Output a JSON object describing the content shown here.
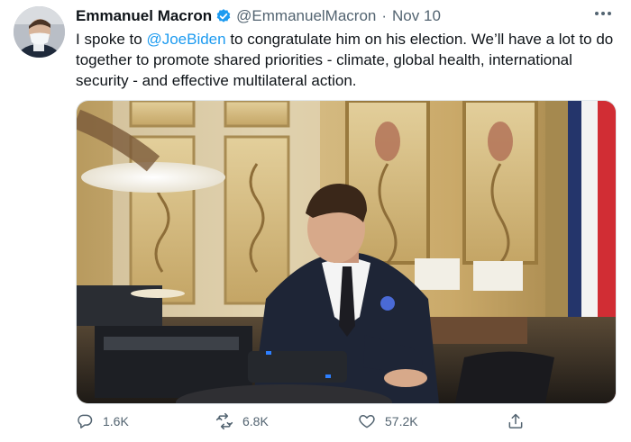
{
  "tweet": {
    "author_name": "Emmanuel Macron",
    "handle": "@EmmanuelMacron",
    "separator": "·",
    "date": "Nov 10",
    "text_before": "I spoke to ",
    "mention": "@JoeBiden",
    "text_after": " to congratulate him on his election. We’ll have a lot to do together to promote shared priorities - climate, global health, international security - and effective multilateral action."
  },
  "icons": {
    "verified": "verified-badge-icon",
    "more": "more-options-icon",
    "reply": "reply-icon",
    "retweet": "retweet-icon",
    "like": "like-icon",
    "share": "share-icon"
  },
  "actions": {
    "reply_count": "1.6K",
    "retweet_count": "6.8K",
    "like_count": "57.2K"
  },
  "colors": {
    "accent": "#1d9bf0",
    "text": "#0f1419",
    "muted": "#536471"
  }
}
